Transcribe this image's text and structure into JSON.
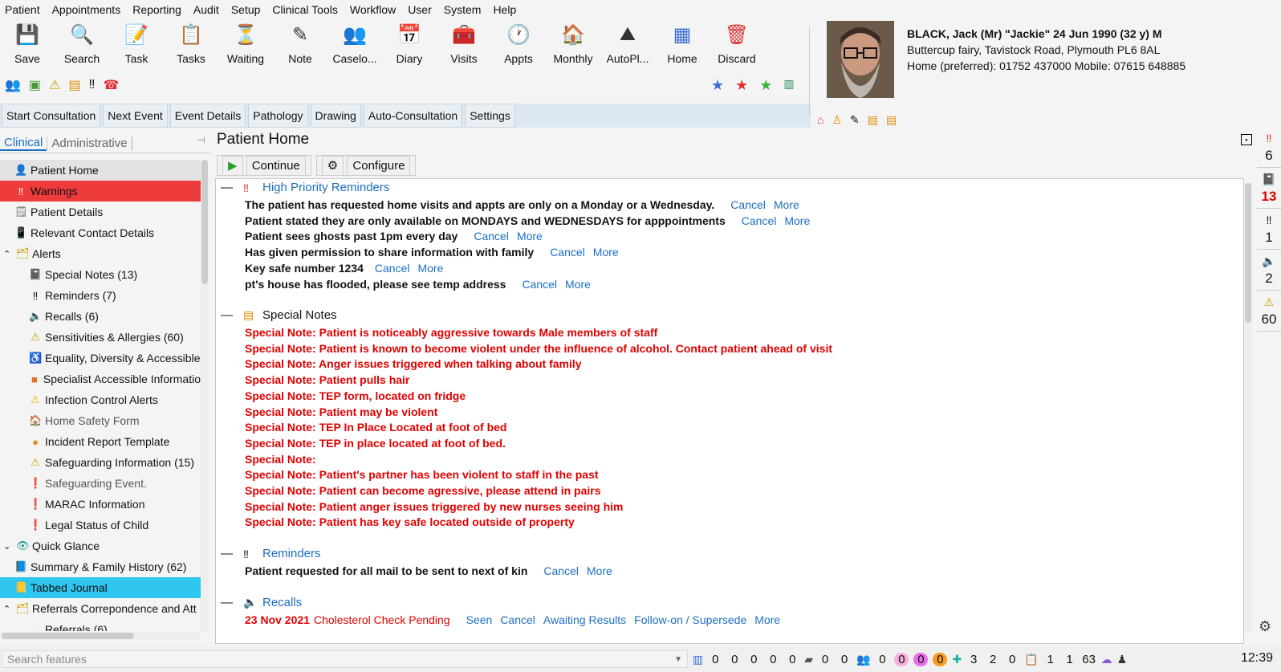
{
  "menu": [
    "Patient",
    "Appointments",
    "Reporting",
    "Audit",
    "Setup",
    "Clinical Tools",
    "Workflow",
    "User",
    "System",
    "Help"
  ],
  "toolbar": [
    {
      "label": "Save",
      "icon": "save-icon",
      "glyph": "💾"
    },
    {
      "label": "Search",
      "icon": "search-icon",
      "glyph": "🔍"
    },
    {
      "label": "Task",
      "icon": "task-icon",
      "glyph": "📝"
    },
    {
      "label": "Tasks",
      "icon": "tasks-icon",
      "glyph": "📋"
    },
    {
      "label": "Waiting",
      "icon": "waiting-icon",
      "glyph": "⏳"
    },
    {
      "label": "Note",
      "icon": "note-icon",
      "glyph": "✎"
    },
    {
      "label": "Caselo...",
      "icon": "caseload-icon",
      "glyph": "👥"
    },
    {
      "label": "Diary",
      "icon": "diary-icon",
      "glyph": "📅"
    },
    {
      "label": "Visits",
      "icon": "visits-icon",
      "glyph": "🧰"
    },
    {
      "label": "Appts",
      "icon": "appts-icon",
      "glyph": "🕐"
    },
    {
      "label": "Monthly",
      "icon": "monthly-icon",
      "glyph": "🏠"
    },
    {
      "label": "AutoPl...",
      "icon": "autoplan-icon",
      "glyph": "⛰"
    },
    {
      "label": "Home",
      "icon": "home-icon",
      "glyph": "▦"
    },
    {
      "label": "Discard",
      "icon": "discard-icon",
      "glyph": "🗑"
    }
  ],
  "consult_tabs": [
    "Start Consultation",
    "Next Event",
    "Event Details",
    "Pathology",
    "Drawing",
    "Auto-Consultation",
    "Settings"
  ],
  "patient": {
    "name": "BLACK, Jack (Mr) \"Jackie\" 24 Jun 1990 (32 y) M",
    "address": "Buttercup fairy, Tavistock Road, Plymouth PL6 8AL",
    "phone": "Home (preferred): 01752 437000 Mobile: 07615 648885"
  },
  "left_tabs": {
    "clinical": "Clinical",
    "administrative": "Administrative"
  },
  "nav": [
    {
      "label": "Patient Home",
      "depth": 0,
      "icon": "person-icon",
      "glyph": "👤",
      "style": "ph"
    },
    {
      "label": "Warnings",
      "depth": 0,
      "icon": "warning-icon",
      "glyph": "‼",
      "style": "sel"
    },
    {
      "label": "Patient Details",
      "depth": 0,
      "icon": "details-icon",
      "glyph": "🗒",
      "style": ""
    },
    {
      "label": "Relevant Contact Details",
      "depth": 0,
      "icon": "phone-icon",
      "glyph": "📱",
      "style": ""
    },
    {
      "label": "Alerts",
      "depth": 0,
      "icon": "folder-icon",
      "glyph": "🗂",
      "style": "",
      "toggle": "^"
    },
    {
      "label": "Special Notes (13)",
      "depth": 1,
      "icon": "special-note-icon",
      "glyph": "📓",
      "style": ""
    },
    {
      "label": "Reminders (7)",
      "depth": 1,
      "icon": "reminder-icon",
      "glyph": "‼",
      "style": ""
    },
    {
      "label": "Recalls (6)",
      "depth": 1,
      "icon": "recall-icon",
      "glyph": "🔈",
      "style": ""
    },
    {
      "label": "Sensitivities & Allergies (60)",
      "depth": 1,
      "icon": "allergy-icon",
      "glyph": "⚠",
      "style": ""
    },
    {
      "label": "Equality, Diversity & Accessible",
      "depth": 1,
      "icon": "accessibility-icon",
      "glyph": "♿",
      "style": ""
    },
    {
      "label": "Specialist Accessible Informatio",
      "depth": 1,
      "icon": "orange-square-icon",
      "glyph": "■",
      "style": ""
    },
    {
      "label": "Infection Control Alerts",
      "depth": 1,
      "icon": "alert-icon",
      "glyph": "⚠",
      "style": ""
    },
    {
      "label": "Home Safety Form",
      "depth": 1,
      "icon": "house-icon",
      "glyph": "🏠",
      "style": "grey"
    },
    {
      "label": "Incident Report Template",
      "depth": 1,
      "icon": "orange-circle-icon",
      "glyph": "●",
      "style": ""
    },
    {
      "label": "Safeguarding Information (15)",
      "depth": 1,
      "icon": "safeguarding-icon",
      "glyph": "⚠",
      "style": ""
    },
    {
      "label": "Safeguarding Event.",
      "depth": 1,
      "icon": "red-alert-icon",
      "glyph": "❗",
      "style": "grey"
    },
    {
      "label": "MARAC Information",
      "depth": 1,
      "icon": "red-alert-icon",
      "glyph": "❗",
      "style": ""
    },
    {
      "label": "Legal Status of Child",
      "depth": 1,
      "icon": "red-alert-icon",
      "glyph": "❗",
      "style": ""
    },
    {
      "label": "Quick Glance",
      "depth": 0,
      "icon": "eye-icon",
      "glyph": "👁",
      "style": "",
      "toggle": "v"
    },
    {
      "label": "Summary & Family History (62)",
      "depth": 0,
      "icon": "book-icon",
      "glyph": "📘",
      "style": ""
    },
    {
      "label": "Tabbed Journal",
      "depth": 0,
      "icon": "journal-icon",
      "glyph": "📒",
      "style": "tab"
    },
    {
      "label": "Referrals Correpondence and Att",
      "depth": 0,
      "icon": "folder-icon",
      "glyph": "🗂",
      "style": "",
      "toggle": "^"
    },
    {
      "label": "Referrals (6)",
      "depth": 1,
      "icon": "arrow-icon",
      "glyph": "→",
      "style": ""
    }
  ],
  "main": {
    "title": "Patient Home",
    "continue": "Continue",
    "configure": "Configure"
  },
  "sections": {
    "hpr": {
      "title": "High Priority Reminders",
      "items": [
        "The patient has requested home visits and appts are only on a Monday or a Wednesday.",
        "Patient stated they are only available on MONDAYS and WEDNESDAYS for apppointments",
        "Patient sees ghosts past 1pm every day",
        "Has given permission to share information with family",
        "Key safe number 1234",
        "pt's house has flooded, please see temp address"
      ]
    },
    "special": {
      "title": "Special Notes",
      "items": [
        "Special Note: Patient is noticeably aggressive towards Male members of staff",
        "Special Note: Patient is known to become violent under the influence of alcohol. Contact patient ahead of visit",
        "Special Note: Anger issues triggered when talking about family",
        "Special Note: Patient pulls hair",
        "Special Note: TEP form, located on fridge",
        "Special Note: Patient may be violent",
        "Special Note: TEP In Place Located at foot of bed",
        "Special Note: TEP in place located at foot of bed.",
        "Special Note:",
        "Special Note: Patient's partner has been violent to staff in the past",
        "Special Note: Patient can become agressive, please attend in pairs",
        "Special Note: Patient anger issues triggered by new nurses seeing him",
        "Special Note: Patient has key safe located outside of property"
      ]
    },
    "reminders": {
      "title": "Reminders",
      "items": [
        "Patient requested for all mail to be sent to next of kin"
      ]
    },
    "recalls": {
      "title": "Recalls",
      "date": "23 Nov 2021",
      "text": "Cholesterol Check Pending",
      "links": [
        "Seen",
        "Cancel",
        "Awaiting Results",
        "Follow-on / Supersede",
        "More"
      ]
    }
  },
  "links": {
    "cancel": "Cancel",
    "more": "More"
  },
  "right_badges": [
    {
      "icon": "warning-icon",
      "glyph": "‼",
      "count": "6",
      "red": false
    },
    {
      "icon": "special-note-icon",
      "glyph": "📓",
      "count": "13",
      "red": true
    },
    {
      "icon": "reminder-icon",
      "glyph": "‼",
      "count": "1",
      "red": false
    },
    {
      "icon": "recall-icon",
      "glyph": "🔈",
      "count": "2",
      "red": false
    },
    {
      "icon": "allergy-icon",
      "glyph": "⚠",
      "count": "60",
      "red": false
    }
  ],
  "status": {
    "search_placeholder": "Search features",
    "counts_a": [
      "0",
      "0",
      "0",
      "0",
      "0"
    ],
    "counts_b": [
      "0",
      "0"
    ],
    "counts_c": [
      "0"
    ],
    "pills": [
      "0",
      "0",
      "0"
    ],
    "counts_d": [
      "3",
      "2",
      "0"
    ],
    "counts_e": [
      "1",
      "1",
      "63"
    ],
    "time": "12:39"
  },
  "colors": {
    "accent": "#1c6ec2",
    "warning_red": "#ee3b3b",
    "journal_cyan": "#2fc6f0",
    "special_red": "#e00000"
  }
}
